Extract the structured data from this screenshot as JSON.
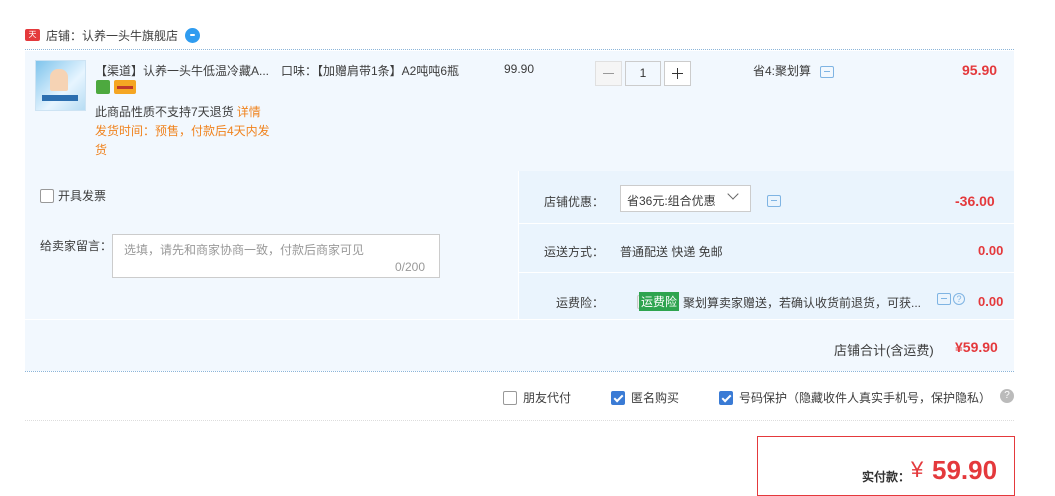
{
  "shop": {
    "badge": "天猫",
    "label": "店铺：认养一头牛旗舰店"
  },
  "item": {
    "title": "【渠道】认养一头牛低温冷藏A...",
    "no_return": "此商品性质不支持7天退货",
    "detail_link": "详情",
    "ship_time": "发货时间：预售，付款后4天内发货",
    "flavor": "口味：【加赠肩带1条】A2吨吨6瓶",
    "unit_price": "99.90",
    "quantity": "1",
    "discount": "省4:聚划算",
    "total": "95.90"
  },
  "invoice": {
    "label": "开具发票"
  },
  "remark": {
    "label": "给卖家留言：",
    "placeholder": "选填，请先和商家协商一致，付款后商家可见",
    "count": "0/200"
  },
  "shop_discount": {
    "label": "店铺优惠：",
    "selected": "省36元:组合优惠",
    "value": "-36.00"
  },
  "shipping": {
    "label": "运送方式：",
    "value": "普通配送 快递 免邮",
    "fee": "0.00"
  },
  "insurance": {
    "label": "运费险：",
    "badge": "运费险",
    "desc": "聚划算卖家赠送，若确认收货前退货，可获...",
    "fee": "0.00"
  },
  "shop_total": {
    "label": "店铺合计(含运费)",
    "value": "¥59.90"
  },
  "options": {
    "friend_pay": {
      "label": "朋友代付",
      "checked": false
    },
    "anonymous": {
      "label": "匿名购买",
      "checked": true
    },
    "privacy": {
      "label": "号码保护（隐藏收件人真实手机号，保护隐私）",
      "checked": true
    }
  },
  "payment": {
    "label": "实付款：",
    "currency": "¥",
    "value": "59.90"
  },
  "colors": {
    "accent_red": "#e4393c",
    "link_orange": "#f0831e",
    "row_bg": "#f2f8fe",
    "check_blue": "#3a7bd5"
  }
}
